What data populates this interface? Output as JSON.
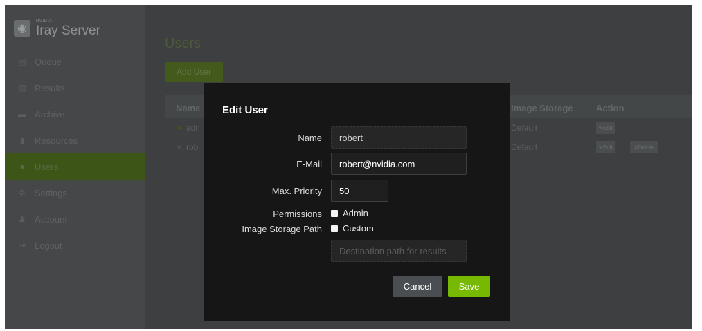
{
  "brand": {
    "small": "NVIDIA.",
    "name": "Iray Server"
  },
  "nav": [
    {
      "label": "Queue",
      "icon": "clipboard-icon"
    },
    {
      "label": "Results",
      "icon": "image-icon"
    },
    {
      "label": "Archive",
      "icon": "archive-icon"
    },
    {
      "label": "Resources",
      "icon": "bar-chart-icon"
    },
    {
      "label": "Users",
      "icon": "users-icon",
      "active": true
    },
    {
      "label": "Settings",
      "icon": "gear-icon"
    },
    {
      "label": "Account",
      "icon": "user-icon"
    },
    {
      "label": "Logout",
      "icon": "logout-icon"
    }
  ],
  "page": {
    "title": "Users",
    "add_user_label": "Add User"
  },
  "table": {
    "headers": {
      "name": "Name",
      "image_storage": "Image Storage",
      "action": "Action"
    },
    "rows": [
      {
        "name": "adr",
        "image_storage": "Default",
        "edit": "Edit",
        "active": true
      },
      {
        "name": "rob",
        "image_storage": "Default",
        "edit": "Edit",
        "delete": "Delete",
        "active": false
      }
    ]
  },
  "modal": {
    "title": "Edit User",
    "name_label": "Name",
    "name_value": "robert",
    "email_label": "E-Mail",
    "email_value": "robert@nvidia.com",
    "priority_label": "Max. Priority",
    "priority_value": "50",
    "permissions_label": "Permissions",
    "permissions_option": "Admin",
    "storage_label": "Image Storage Path",
    "storage_option": "Custom",
    "destination_placeholder": "Destination path for results",
    "cancel_label": "Cancel",
    "save_label": "Save"
  },
  "colors": {
    "accent": "#76b900",
    "modal_bg": "#161616"
  }
}
